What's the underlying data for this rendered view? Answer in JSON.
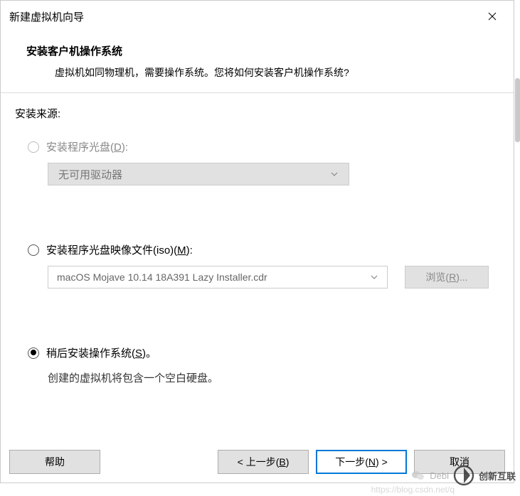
{
  "title": "新建虚拟机向导",
  "header": {
    "title": "安装客户机操作系统",
    "desc": "虚拟机如同物理机，需要操作系统。您将如何安装客户机操作系统?"
  },
  "source_label": "安装来源:",
  "options": {
    "disc": {
      "label_pre": "安装程序光盘(",
      "hotkey": "D",
      "label_post": "):",
      "dropdown_text": "无可用驱动器"
    },
    "iso": {
      "label_pre": "安装程序光盘映像文件(iso)(",
      "hotkey": "M",
      "label_post": "):",
      "combo_value": "macOS Mojave 10.14 18A391 Lazy Installer.cdr",
      "browse_pre": "浏览(",
      "browse_hotkey": "R",
      "browse_post": ")..."
    },
    "later": {
      "label_pre": "稍后安装操作系统(",
      "hotkey": "S",
      "label_post": ")。",
      "note": "创建的虚拟机将包含一个空白硬盘。"
    }
  },
  "footer": {
    "help": "帮助",
    "back_pre": "< 上一步(",
    "back_hotkey": "B",
    "back_post": ")",
    "next_pre": "下一步(",
    "next_hotkey": "N",
    "next_post": ") >",
    "cancel": "取消"
  },
  "watermark": {
    "chat": "Debi",
    "brand": "创新互联",
    "url": "https://blog.csdn.net/q"
  }
}
